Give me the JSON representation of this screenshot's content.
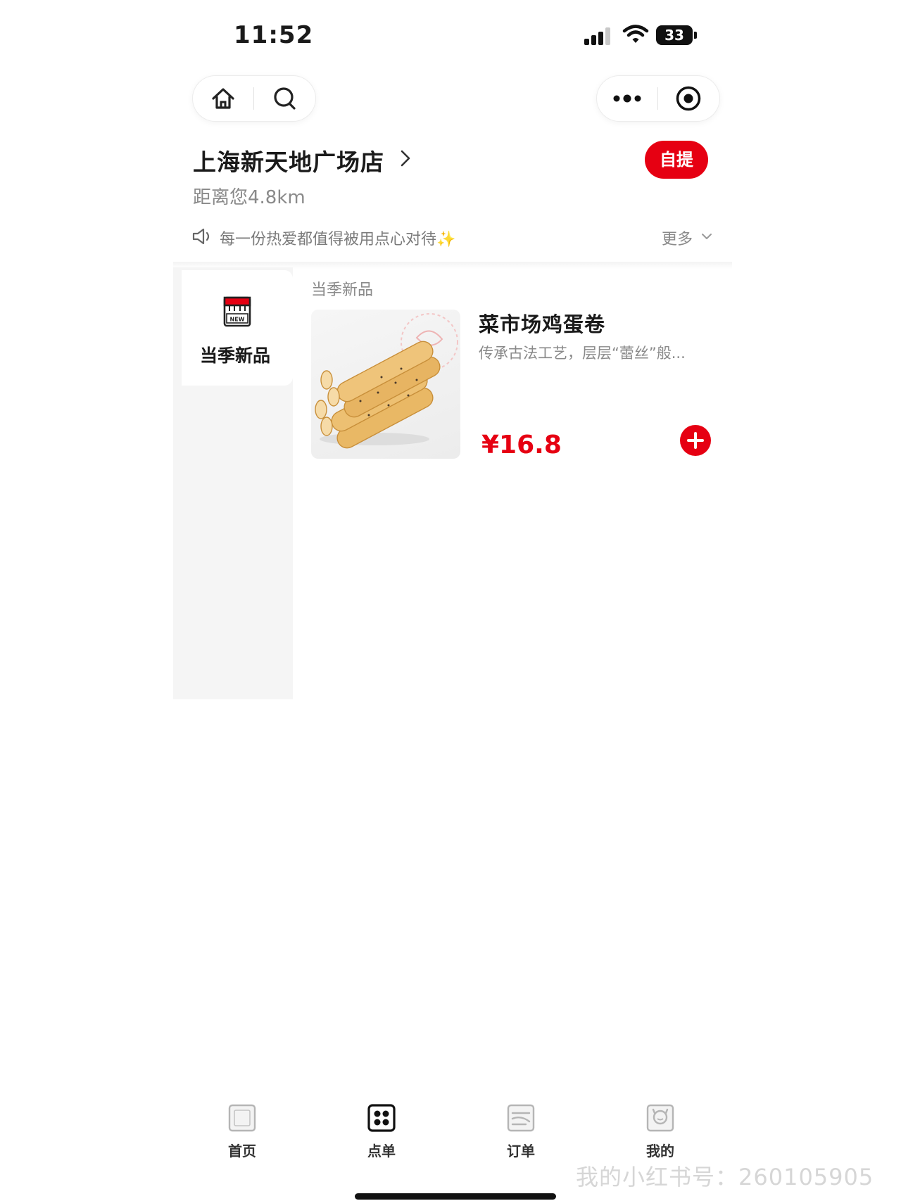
{
  "status_bar": {
    "time": "11:52",
    "battery": "33"
  },
  "store": {
    "name": "上海新天地广场店",
    "distance": "距离您4.8km",
    "pickup_label": "自提"
  },
  "notice": {
    "text": "每一份热爱都值得被用点心对待✨",
    "more_label": "更多"
  },
  "categories": [
    {
      "label": "当季新品",
      "badge": "NEW"
    }
  ],
  "section": {
    "title": "当季新品"
  },
  "products": [
    {
      "name": "菜市场鸡蛋卷",
      "description": "传承古法工艺，层层“蕾丝”般...",
      "price": "¥16.8"
    }
  ],
  "tabbar": {
    "items": [
      {
        "label": "首页",
        "icon": "home-tab-icon"
      },
      {
        "label": "点单",
        "icon": "order-menu-tab-icon"
      },
      {
        "label": "订单",
        "icon": "orders-tab-icon"
      },
      {
        "label": "我的",
        "icon": "profile-tab-icon"
      }
    ]
  },
  "watermark": "我的小红书号：260105905",
  "colors": {
    "accent": "#e60012",
    "muted_text": "#8a8a8a",
    "sidebar_bg": "#f5f5f5"
  }
}
